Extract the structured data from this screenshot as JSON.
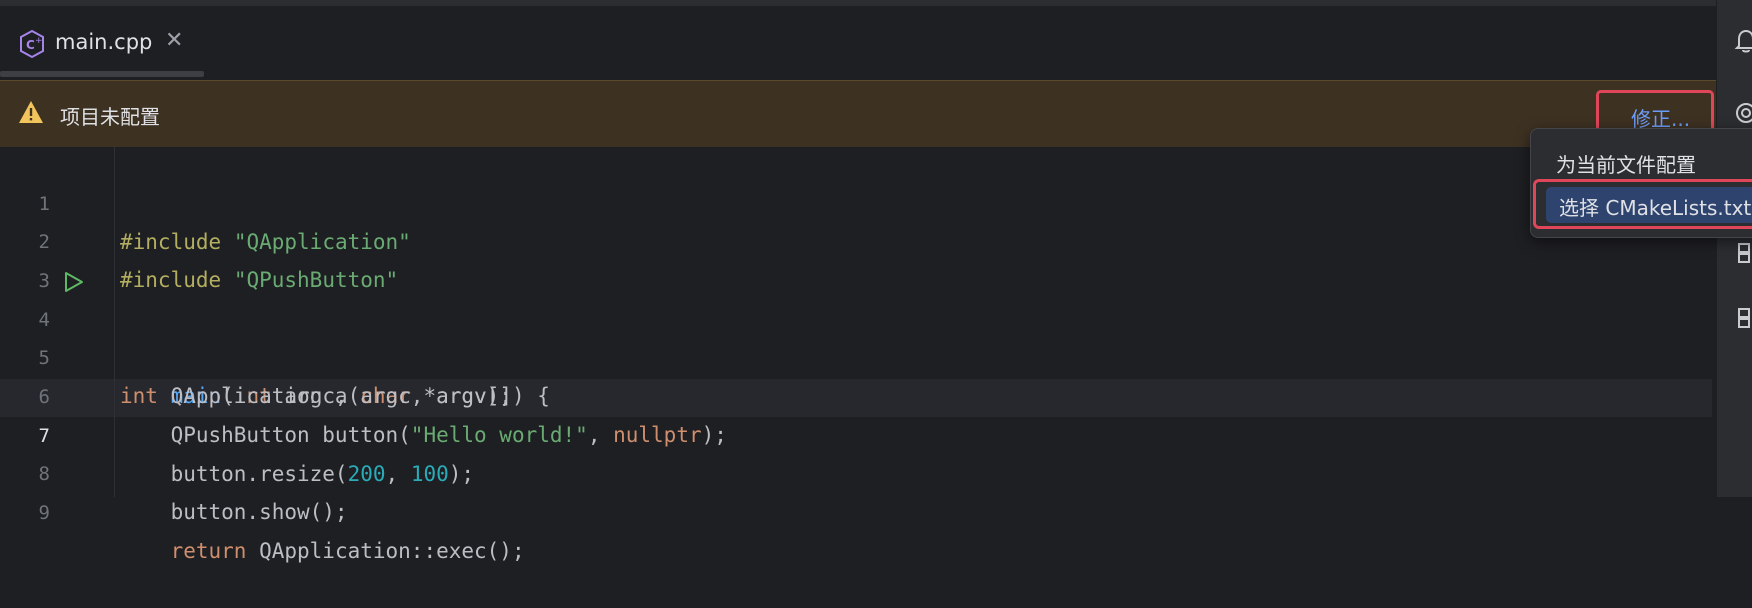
{
  "tab": {
    "filename": "main.cpp",
    "close_glyph": "✕",
    "file_icon": "cpp-file-icon"
  },
  "banner": {
    "message": "项目未配置",
    "fix_label": "修正...",
    "icon": "warning-icon"
  },
  "popup": {
    "items": [
      "为当前文件配置",
      "选择 CMakeLists.txt"
    ]
  },
  "editor": {
    "current_line": 7,
    "line_numbers": [
      "1",
      "2",
      "3",
      "4",
      "5",
      "6",
      "7",
      "8",
      "9"
    ]
  },
  "colors": {
    "string": "#6aab73",
    "keyword": "#cf8e6d",
    "function": "#56a8f5",
    "number": "#2aacb8",
    "preprocessor": "#b3ae60",
    "highlight": "#e0465a"
  },
  "code": {
    "l1": {
      "pre": "#include",
      "str": "\"QApplication\""
    },
    "l2": {
      "pre": "#include",
      "str": "\"QPushButton\""
    },
    "l4": {
      "t1": "int",
      "fn": "main",
      "p1": "(",
      "t2": "int",
      "p2": " argc, ",
      "t3": "char",
      "p3": " *argv[]) {"
    },
    "l5": {
      "text": "    QApplication a(argc, argv);"
    },
    "l6": {
      "a": "    QPushButton button(",
      "str": "\"Hello world!\"",
      "b": ", ",
      "kw": "nullptr",
      "c": ");"
    },
    "l7": {
      "a": "    button.resize(",
      "n1": "200",
      "b": ", ",
      "n2": "100",
      "c": ");"
    },
    "l8": {
      "text": "    button.show();"
    },
    "l9": {
      "kw": "    return",
      "rest": " QApplication::exec();"
    }
  }
}
